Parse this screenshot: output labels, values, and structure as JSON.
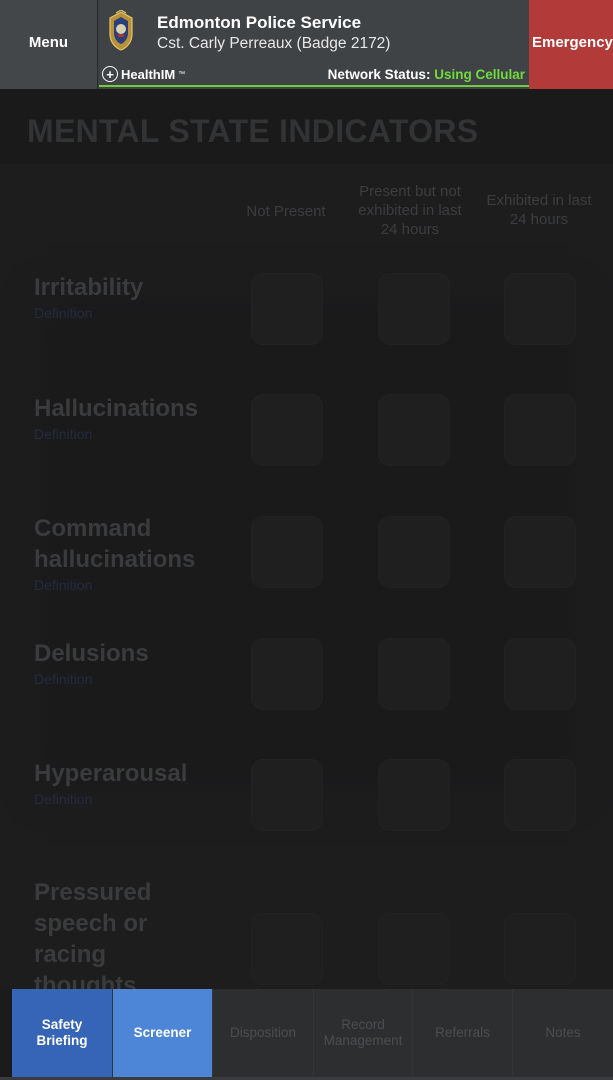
{
  "header": {
    "menu_label": "Menu",
    "org_name": "Edmonton Police Service",
    "officer": "Cst. Carly Perreaux (Badge 2172)",
    "brand": "HealthIM",
    "brand_tm": "™",
    "network_label": "Network Status:",
    "network_value": "Using Cellular",
    "emergency_label": "Emergency",
    "network_color": "#6fdb3c",
    "emergency_color": "#b23a38"
  },
  "page": {
    "title": "MENTAL STATE INDICATORS",
    "columns": [
      "Not Present",
      "Present but not exhibited in last 24 hours",
      "Exhibited in last 24 hours"
    ],
    "definition_label": "Definition",
    "indicators": [
      {
        "name": "Irritability",
        "has_definition": true
      },
      {
        "name": "Hallucinations",
        "has_definition": true
      },
      {
        "name": "Command hallucinations",
        "has_definition": true
      },
      {
        "name": "Delusions",
        "has_definition": true
      },
      {
        "name": "Hyperarousal",
        "has_definition": true
      },
      {
        "name": "Pressured speech or racing thoughts",
        "has_definition": false
      }
    ]
  },
  "bottom_nav": {
    "tabs": [
      {
        "label": "Safety Briefing",
        "state": "completed"
      },
      {
        "label": "Screener",
        "state": "active"
      },
      {
        "label": "Disposition",
        "state": "disabled"
      },
      {
        "label": "Record Management",
        "state": "disabled"
      },
      {
        "label": "Referrals",
        "state": "disabled"
      },
      {
        "label": "Notes",
        "state": "disabled"
      }
    ],
    "active_color": "#4d86d6",
    "completed_color": "#3664b6"
  }
}
